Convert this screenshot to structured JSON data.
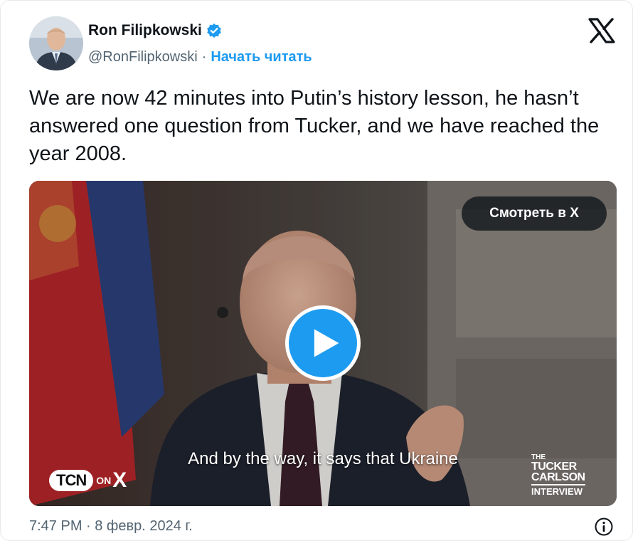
{
  "author": {
    "name": "Ron Filipkowski",
    "handle": "@RonFilipkowski",
    "separator": "·",
    "follow_label": "Начать читать",
    "verified_icon": "verified-badge-icon",
    "verified_color": "#1d9bf0"
  },
  "tweet": {
    "text": "We are now 42 minutes into Putin’s history lesson, he hasn’t answered one question from Tucker, and we have reached the year 2008."
  },
  "media": {
    "watch_button_label": "Смотреть в X",
    "subtitle": "And by the way, it says that Ukraine",
    "play_icon": "play-icon",
    "tcn_logo_text": "TCN",
    "tcn_on_text": "ON",
    "tcn_x_text": "X",
    "tucker_logo": {
      "line1": "THE",
      "line2": "TUCKER",
      "line3": "CARLSON",
      "line4": "INTERVIEW"
    }
  },
  "footer": {
    "timestamp": "7:47 PM · 8 февр. 2024 г.",
    "info_icon": "info-icon"
  },
  "colors": {
    "accent": "#1d9bf0",
    "text_primary": "#0f1419",
    "text_secondary": "#536471"
  }
}
